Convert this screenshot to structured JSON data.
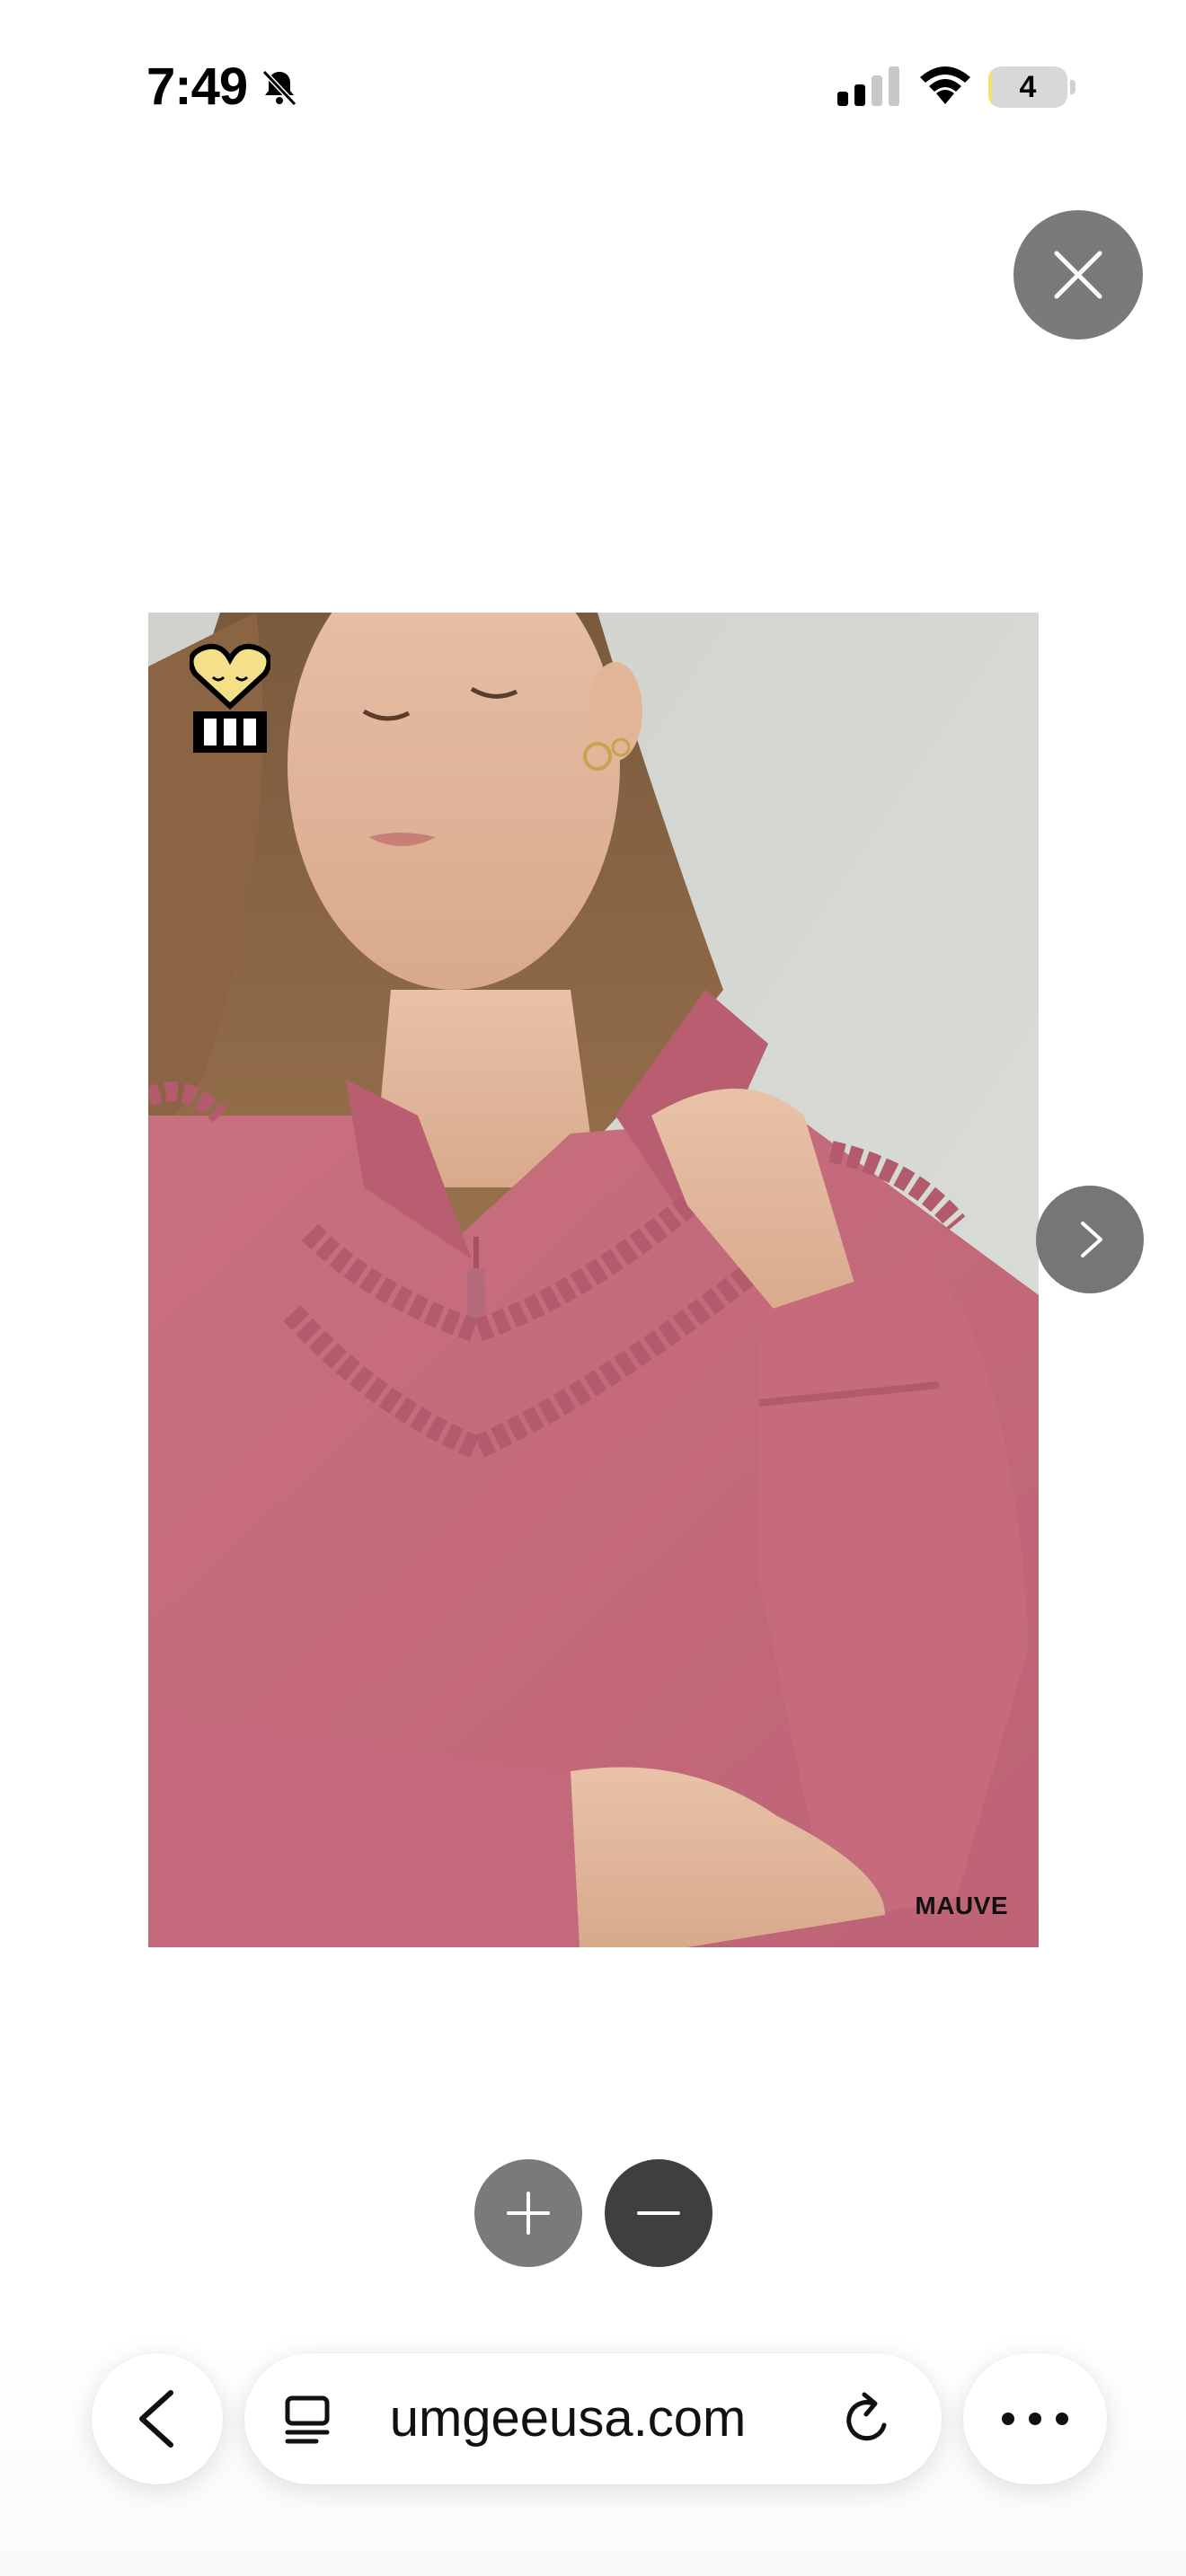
{
  "status_bar": {
    "time": "7:49",
    "battery_level": "4",
    "battery_fraction": 0.04,
    "icons": [
      "bell-slash-icon",
      "cellular-signal-icon",
      "wifi-icon",
      "battery-icon"
    ]
  },
  "lightbox": {
    "close_icon": "close-icon",
    "next_icon": "chevron-right-icon",
    "zoom_in_icon": "plus-icon",
    "zoom_out_icon": "minus-icon"
  },
  "product": {
    "color_name": "MAUVE",
    "logo_icon": "heart-logo-icon"
  },
  "browser": {
    "url": "umgeeusa.com",
    "back_icon": "chevron-left-icon",
    "tabs_icon": "tabs-icon",
    "reload_icon": "reload-icon",
    "more_icon": "more-icon"
  },
  "colors": {
    "button_gray": "#7a7a7a",
    "button_dark": "#3f3f3f",
    "sweater": "#c96f82",
    "backdrop": "#d5d7d3",
    "battery_fill": "#f5e06a"
  }
}
